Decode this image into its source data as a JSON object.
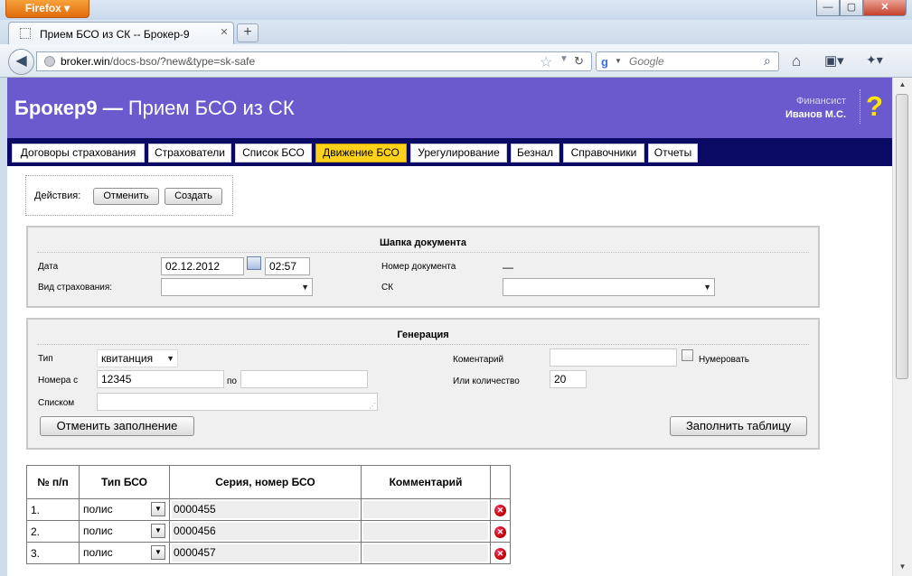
{
  "browser": {
    "app_button": "Firefox",
    "tab_title": "Прием БСО из СК -- Брокер-9",
    "url_host": "broker.win",
    "url_path": "/docs-bso/?new&type=sk-safe",
    "search_placeholder": "Google"
  },
  "header": {
    "brand": "Брокер9",
    "separator": " — ",
    "page_title": "Прием БСО из СК",
    "user_role": "Финансист",
    "user_name": "Иванов М.С.",
    "help": "?"
  },
  "menu": {
    "items": [
      {
        "label": "Договоры страхования"
      },
      {
        "label": "Страхователи"
      },
      {
        "label": "Список БСО"
      },
      {
        "label": "Движение БСО",
        "active": true
      },
      {
        "label": "Урегулирование"
      },
      {
        "label": "Безнал"
      },
      {
        "label": "Справочники"
      },
      {
        "label": "Отчеты"
      }
    ]
  },
  "actions": {
    "label": "Действия:",
    "cancel": "Отменить",
    "create": "Создать"
  },
  "doc_header": {
    "title": "Шапка документа",
    "date_label": "Дата",
    "date_value": "02.12.2012",
    "time_value": "02:57",
    "insurance_type_label": "Вид страхования:",
    "insurance_type_value": "",
    "doc_number_label": "Номер документа",
    "doc_number_value": "—",
    "sk_label": "СК",
    "sk_value": ""
  },
  "generation": {
    "title": "Генерация",
    "type_label": "Тип",
    "type_value": "квитанция",
    "numbers_from_label": "Номера с",
    "numbers_from_value": "12345",
    "numbers_to_label": "по",
    "numbers_to_value": "",
    "list_label": "Списком",
    "list_value": "",
    "comment_label": "Коментарий",
    "comment_value": "",
    "numerate_label": "Нумеровать",
    "count_label": "Или количество",
    "count_value": "20",
    "clear_button": "Отменить заполнение",
    "fill_button": "Заполнить таблицу"
  },
  "table": {
    "columns": [
      "№ п/п",
      "Тип БСО",
      "Серия, номер БСО",
      "Комментарий",
      ""
    ],
    "rows": [
      {
        "num": "1.",
        "type": "полис",
        "series": "0000455",
        "comment": ""
      },
      {
        "num": "2.",
        "type": "полис",
        "series": "0000456",
        "comment": ""
      },
      {
        "num": "3.",
        "type": "полис",
        "series": "0000457",
        "comment": ""
      }
    ]
  },
  "colors": {
    "header_bg": "#6a5acd",
    "menu_bg": "#0a0a64",
    "active_menu": "#ffd21a",
    "help_icon": "#ffe400"
  },
  "icons": [
    "firefox-menu",
    "back-arrow-icon",
    "globe-icon",
    "bookmark-star-icon",
    "reload-icon",
    "google-icon",
    "search-icon",
    "home-icon",
    "bookmarks-icon",
    "addon-icon",
    "calendar-icon",
    "delete-row-icon",
    "resize-grip-icon"
  ]
}
